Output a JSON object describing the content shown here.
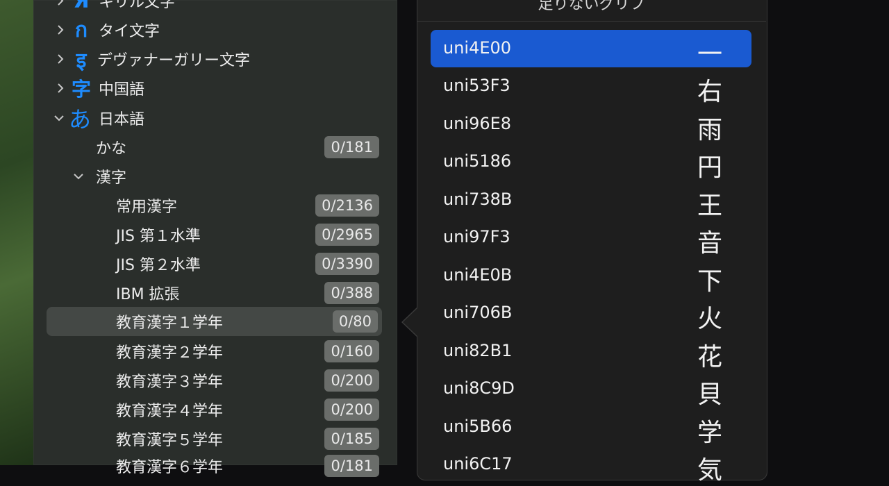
{
  "sidebar": {
    "items": [
      {
        "label": "キリル文字",
        "icon_glyph": "Я",
        "icon": "cyrillic-script-icon",
        "expanded": false,
        "badge": ""
      },
      {
        "label": "タイ文字",
        "icon_glyph": "ก",
        "icon": "thai-script-icon",
        "expanded": false,
        "badge": ""
      },
      {
        "label": "デヴァナーガリー文字",
        "icon_glyph": "इ",
        "icon": "devanagari-script-icon",
        "expanded": false,
        "badge": ""
      },
      {
        "label": "中国語",
        "icon_glyph": "字",
        "icon": "chinese-script-icon",
        "expanded": false,
        "badge": ""
      },
      {
        "label": "日本語",
        "icon_glyph": "あ",
        "icon": "japanese-script-icon",
        "expanded": true,
        "badge": ""
      },
      {
        "label": "かな",
        "badge": "0/181"
      },
      {
        "label": "漢字",
        "expanded": true,
        "badge": ""
      },
      {
        "label": "常用漢字",
        "badge": "0/2136"
      },
      {
        "label": "JIS 第１水準",
        "badge": "0/2965"
      },
      {
        "label": "JIS 第２水準",
        "badge": "0/3390"
      },
      {
        "label": "IBM 拡張",
        "badge": "0/388"
      },
      {
        "label": "教育漢字１学年",
        "badge": "0/80",
        "selected": true
      },
      {
        "label": "教育漢字２学年",
        "badge": "0/160"
      },
      {
        "label": "教育漢字３学年",
        "badge": "0/200"
      },
      {
        "label": "教育漢字４学年",
        "badge": "0/200"
      },
      {
        "label": "教育漢字５学年",
        "badge": "0/185"
      },
      {
        "label": "教育漢字６学年",
        "badge": "0/181"
      }
    ]
  },
  "popover": {
    "title": "足りないグリフ",
    "glyphs": [
      {
        "name": "uni4E00",
        "char": "一",
        "selected": true
      },
      {
        "name": "uni53F3",
        "char": "右"
      },
      {
        "name": "uni96E8",
        "char": "雨"
      },
      {
        "name": "uni5186",
        "char": "円"
      },
      {
        "name": "uni738B",
        "char": "王"
      },
      {
        "name": "uni97F3",
        "char": "音"
      },
      {
        "name": "uni4E0B",
        "char": "下"
      },
      {
        "name": "uni706B",
        "char": "火"
      },
      {
        "name": "uni82B1",
        "char": "花"
      },
      {
        "name": "uni8C9D",
        "char": "貝"
      },
      {
        "name": "uni5B66",
        "char": "学"
      },
      {
        "name": "uni6C17",
        "char": "気"
      }
    ]
  },
  "colors": {
    "accent": "#1a5ad1",
    "script_icon": "#1e8cff",
    "sidebar_bg": "#2a2e2b",
    "popover_bg": "#1e1e1e",
    "badge_bg": "#6a6d6a"
  }
}
